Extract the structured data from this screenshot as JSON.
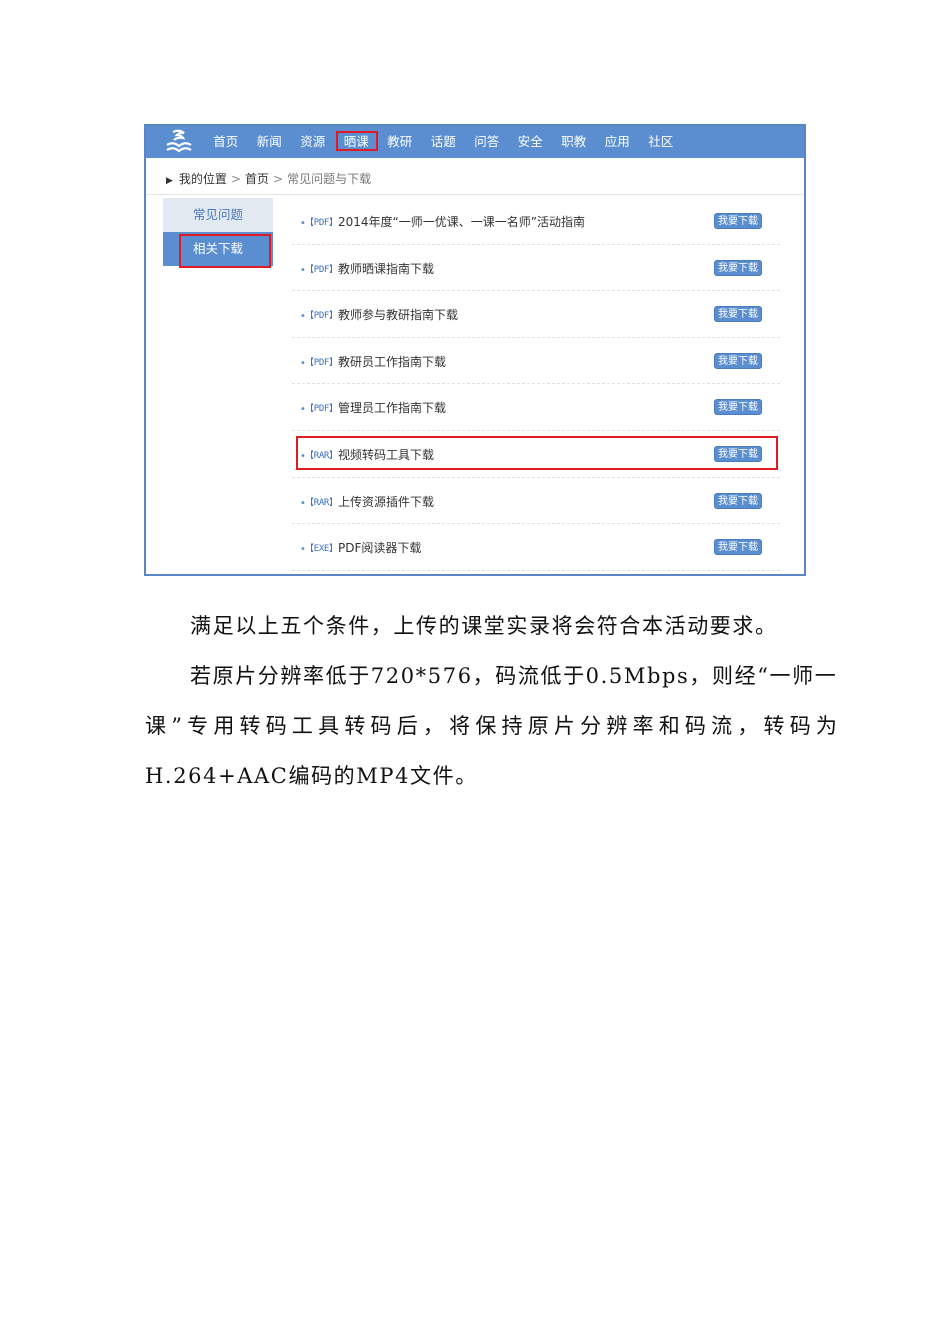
{
  "screenshot": {
    "nav": {
      "logo_icon": "open-book-wave-logo",
      "items": [
        "首页",
        "新闻",
        "资源",
        "晒课",
        "教研",
        "话题",
        "问答",
        "安全",
        "职教",
        "应用",
        "社区"
      ],
      "highlighted_index": 3
    },
    "breadcrumb": {
      "label": "我的位置",
      "home": "首页",
      "current": "常见问题与下载"
    },
    "sidebar": {
      "items": [
        {
          "label": "常见问题",
          "active": false
        },
        {
          "label": "相关下载",
          "active": true
        }
      ]
    },
    "files": [
      {
        "type": "【PDF】",
        "name": "2014年度“一师一优课、一课一名师”活动指南",
        "button": "我要下载"
      },
      {
        "type": "【PDF】",
        "name": "教师晒课指南下载",
        "button": "我要下载"
      },
      {
        "type": "【PDF】",
        "name": "教师参与教研指南下载",
        "button": "我要下载"
      },
      {
        "type": "【PDF】",
        "name": "教研员工作指南下载",
        "button": "我要下载"
      },
      {
        "type": "【PDF】",
        "name": "管理员工作指南下载",
        "button": "我要下载"
      },
      {
        "type": "【RAR】",
        "name": "视频转码工具下载",
        "button": "我要下载",
        "highlighted": true
      },
      {
        "type": "【RAR】",
        "name": "上传资源插件下载",
        "button": "我要下载"
      },
      {
        "type": "【EXE】",
        "name": "PDF阅读器下载",
        "button": "我要下载"
      }
    ],
    "colors": {
      "nav_blue": "#5a8ed0",
      "highlight_red": "#e01a23",
      "sidebar_inactive": "#e3e9f1"
    }
  },
  "document": {
    "para1": "满足以上五个条件，上传的课堂实录将会符合本活动要求。",
    "para2_line1": "若原片分辨率低于720*576，码流低于0.5Mbps，则经“一师一",
    "para2_line2": "课”专用转码工具转码后，将保持原片分辨率和码流，转码为",
    "para2_line3": "H.264+AAC编码的MP4文件。"
  }
}
